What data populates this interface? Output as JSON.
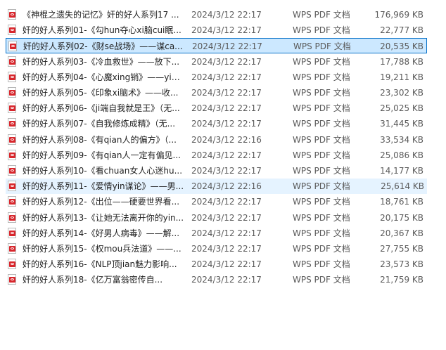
{
  "file_list": {
    "selected_index": 2,
    "hover_index": 11,
    "rows": [
      {
        "name": "《神棍之遗失的记忆》奸的好人系列17 ...",
        "date": "2024/3/12 22:17",
        "type": "WPS PDF 文档",
        "size": "176,969 KB",
        "icon": "pdf-icon"
      },
      {
        "name": "奸的好人系列01-《勾hun夺心xi脑cui眠...",
        "date": "2024/3/12 22:17",
        "type": "WPS PDF 文档",
        "size": "22,777 KB",
        "icon": "pdf-icon"
      },
      {
        "name": "奸的好人系列02-《财se战场》——谋ca...",
        "date": "2024/3/12 22:17",
        "type": "WPS PDF 文档",
        "size": "20,535 KB",
        "icon": "pdf-icon"
      },
      {
        "name": "奸的好人系列03-《冷血救世》——放下...",
        "date": "2024/3/12 22:17",
        "type": "WPS PDF 文档",
        "size": "17,788 KB",
        "icon": "pdf-icon"
      },
      {
        "name": "奸的好人系列04-《心魔xing销》——yin...",
        "date": "2024/3/12 22:17",
        "type": "WPS PDF 文档",
        "size": "19,211 KB",
        "icon": "pdf-icon"
      },
      {
        "name": "奸的好人系列05-《印象xi脑术》——收...",
        "date": "2024/3/12 22:17",
        "type": "WPS PDF 文档",
        "size": "23,302 KB",
        "icon": "pdf-icon"
      },
      {
        "name": "奸的好人系列06-《ji端自我就是王》（无...",
        "date": "2024/3/12 22:17",
        "type": "WPS PDF 文档",
        "size": "25,025 KB",
        "icon": "pdf-icon"
      },
      {
        "name": "奸的好人系列07-《自我修炼成精》（无...",
        "date": "2024/3/12 22:17",
        "type": "WPS PDF 文档",
        "size": "31,445 KB",
        "icon": "pdf-icon"
      },
      {
        "name": "奸的好人系列08-《有qian人的偏方》（...",
        "date": "2024/3/12 22:16",
        "type": "WPS PDF 文档",
        "size": "33,534 KB",
        "icon": "pdf-icon"
      },
      {
        "name": "奸的好人系列09-《有qian人一定有偏见...",
        "date": "2024/3/12 22:17",
        "type": "WPS PDF 文档",
        "size": "25,086 KB",
        "icon": "pdf-icon"
      },
      {
        "name": "奸的好人系列10-《看chuan女人心迷hu...",
        "date": "2024/3/12 22:17",
        "type": "WPS PDF 文档",
        "size": "14,177 KB",
        "icon": "pdf-icon"
      },
      {
        "name": "奸的好人系列11-《爱情yin谋论》——男...",
        "date": "2024/3/12 22:16",
        "type": "WPS PDF 文档",
        "size": "25,614 KB",
        "icon": "pdf-icon"
      },
      {
        "name": "奸的好人系列12-《出位——硬要世界看...",
        "date": "2024/3/12 22:17",
        "type": "WPS PDF 文档",
        "size": "18,761 KB",
        "icon": "pdf-icon"
      },
      {
        "name": "奸的好人系列13-《让她无法离开你的yin...",
        "date": "2024/3/12 22:17",
        "type": "WPS PDF 文档",
        "size": "20,175 KB",
        "icon": "pdf-icon"
      },
      {
        "name": "奸的好人系列14-《好男人病毒》——解...",
        "date": "2024/3/12 22:17",
        "type": "WPS PDF 文档",
        "size": "20,367 KB",
        "icon": "pdf-icon"
      },
      {
        "name": "奸的好人系列15-《权mou兵法道》——...",
        "date": "2024/3/12 22:17",
        "type": "WPS PDF 文档",
        "size": "27,755 KB",
        "icon": "pdf-icon"
      },
      {
        "name": "奸的好人系列16-《NLP顶jian魅力影响...",
        "date": "2024/3/12 22:17",
        "type": "WPS PDF 文档",
        "size": "23,573 KB",
        "icon": "pdf-icon"
      },
      {
        "name": "奸的好人系列18-《亿万富翁密传自...",
        "date": "2024/3/12 22:17",
        "type": "WPS PDF 文档",
        "size": "21,759 KB",
        "icon": "pdf-icon"
      }
    ]
  }
}
